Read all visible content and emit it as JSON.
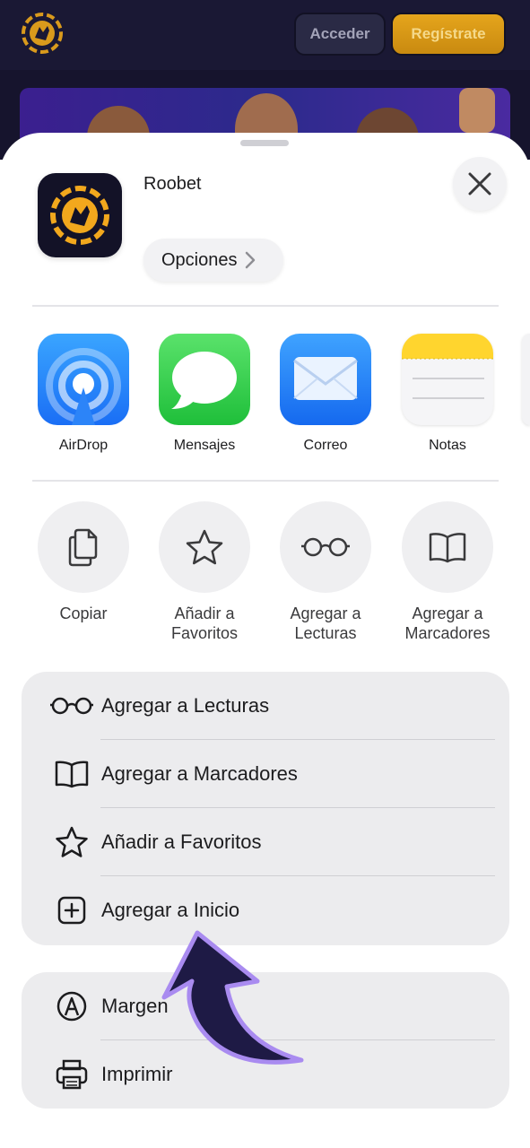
{
  "website": {
    "login_label": "Acceder",
    "register_label": "Regístrate"
  },
  "share_sheet": {
    "app_name": "Roobet",
    "options_label": "Opciones",
    "apps": [
      {
        "label": "AirDrop"
      },
      {
        "label": "Mensajes"
      },
      {
        "label": "Correo"
      },
      {
        "label": "Notas"
      }
    ],
    "actions": [
      {
        "line1": "Copiar",
        "line2": ""
      },
      {
        "line1": "Añadir a",
        "line2": "Favoritos"
      },
      {
        "line1": "Agregar a",
        "line2": "Lecturas"
      },
      {
        "line1": "Agregar a",
        "line2": "Marcadores"
      }
    ],
    "list_primary": [
      {
        "label": "Agregar a Lecturas",
        "icon": "glasses-icon"
      },
      {
        "label": "Agregar a Marcadores",
        "icon": "book-icon"
      },
      {
        "label": "Añadir a Favoritos",
        "icon": "star-icon"
      },
      {
        "label": "Agregar a Inicio",
        "icon": "plus-square-icon"
      }
    ],
    "list_secondary": [
      {
        "label": "Margen",
        "icon": "markup-pen-icon"
      },
      {
        "label": "Imprimir",
        "icon": "printer-icon"
      }
    ]
  },
  "colors": {
    "brand_gold": "#f2a81d",
    "site_dark": "#1a1834",
    "annotation_arrow": "#1e1a45",
    "annotation_outline": "#a98bf0"
  }
}
